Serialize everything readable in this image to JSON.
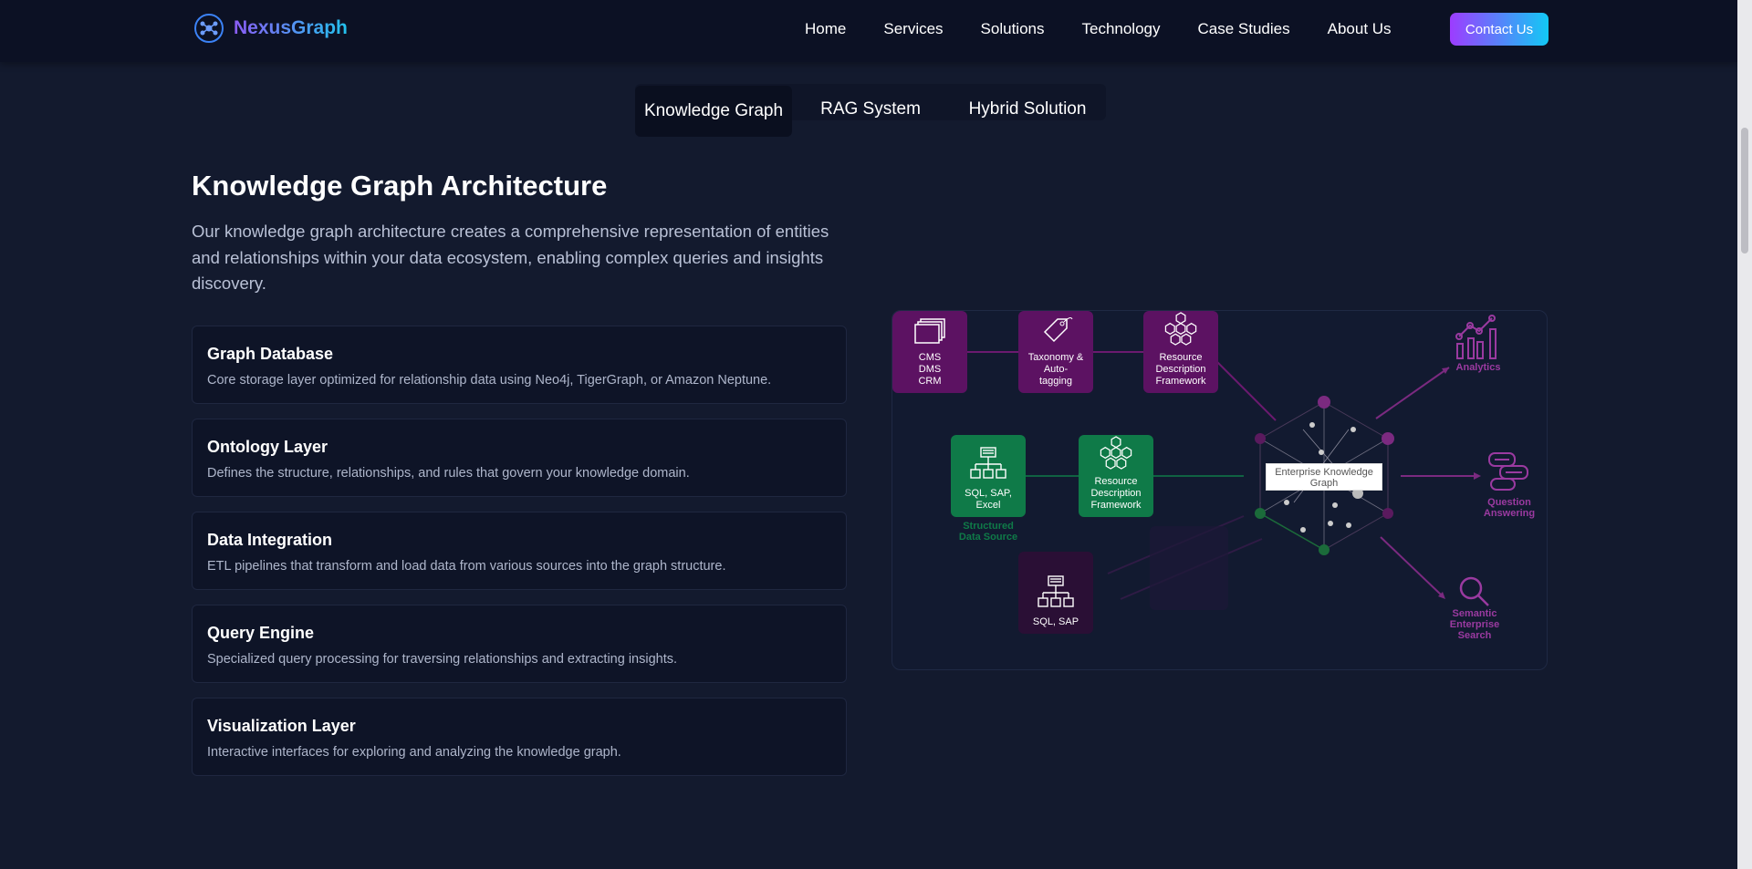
{
  "brand": {
    "name": "NexusGraph",
    "logo_icon": "network-node-icon",
    "accent_start": "#8b5cf6",
    "accent_end": "#22c3ee"
  },
  "nav": {
    "links": [
      "Home",
      "Services",
      "Solutions",
      "Technology",
      "Case Studies",
      "About Us"
    ],
    "contact_label": "Contact Us"
  },
  "tabs": [
    "Knowledge Graph",
    "RAG System",
    "Hybrid Solution"
  ],
  "active_tab": "Knowledge Graph",
  "section": {
    "title": "Knowledge Graph Architecture",
    "description": "Our knowledge graph architecture creates a comprehensive representation of entities and relationships within your data ecosystem, enabling complex queries and insights discovery."
  },
  "components": [
    {
      "title": "Graph Database",
      "desc": "Core storage layer optimized for relationship data using Neo4j, TigerGraph, or Amazon Neptune."
    },
    {
      "title": "Ontology Layer",
      "desc": "Defines the structure, relationships, and rules that govern your knowledge domain."
    },
    {
      "title": "Data Integration",
      "desc": "ETL pipelines that transform and load data from various sources into the graph structure."
    },
    {
      "title": "Query Engine",
      "desc": "Specialized query processing for traversing relationships and extracting insights."
    },
    {
      "title": "Visualization Layer",
      "desc": "Interactive interfaces for exploring and analyzing the knowledge graph."
    }
  ],
  "diagram": {
    "nodes": {
      "cms": "CMS\nDMS\nCRM",
      "taxonomy": "Taxonomy &\nAuto-\ntagging",
      "rdf_top": "Resource\nDescription\nFramework",
      "sql_excel": "SQL, SAP,\nExcel",
      "rdf_mid": "Resource\nDescription\nFramework",
      "sql_sap": "SQL, SAP"
    },
    "structured_source_label": "Structured\nData Source",
    "ekg_label": "Enterprise Knowledge\nGraph",
    "outputs": [
      "Analytics",
      "Question\nAnswering",
      "Semantic\nEnterprise\nSearch"
    ],
    "colors": {
      "purple": "#5c1262",
      "green": "#0f7a48",
      "output": "#9a3aa0"
    }
  }
}
